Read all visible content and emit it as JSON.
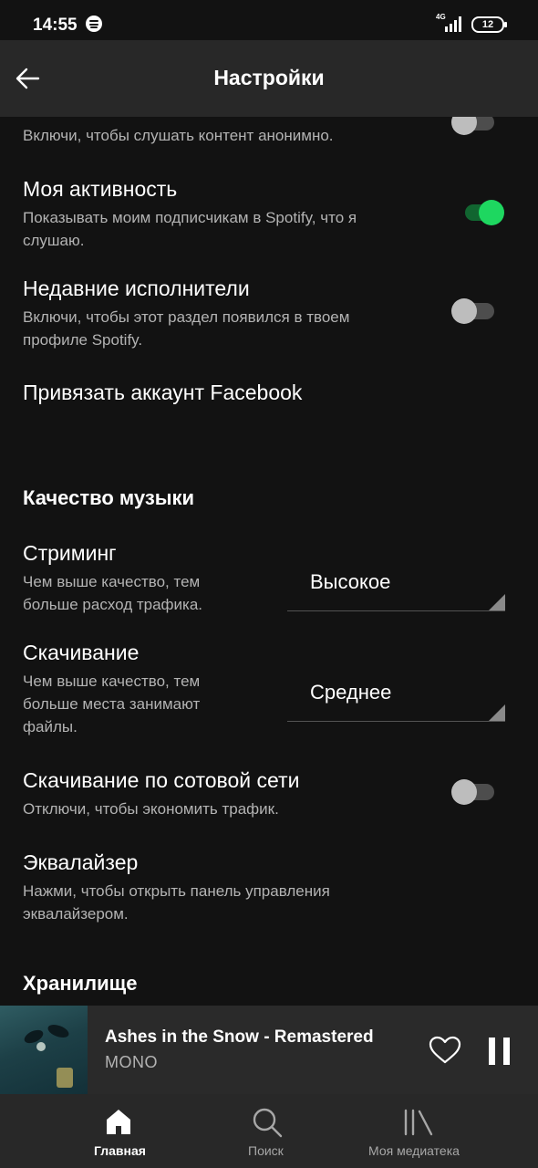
{
  "status_bar": {
    "time": "14:55",
    "network": "4G",
    "battery": "12"
  },
  "header": {
    "title": "Настройки"
  },
  "settings": {
    "private_session": {
      "description": "Включи, чтобы слушать контент анонимно.",
      "enabled": false
    },
    "my_activity": {
      "title": "Моя активность",
      "description_line1": "Показывать моим подписчикам в Spotify, что я",
      "description_line2": "слушаю.",
      "enabled": true
    },
    "recent_artists": {
      "title": "Недавние исполнители",
      "description_line1": "Включи, чтобы этот раздел появился в твоем",
      "description_line2": "профиле Spotify.",
      "enabled": false
    },
    "facebook_link": {
      "title": "Привязать аккаунт Facebook"
    },
    "music_quality": {
      "header": "Качество музыки",
      "streaming": {
        "title": "Стриминг",
        "description_line1": "Чем выше качество, тем",
        "description_line2": "больше расход трафика.",
        "value": "Высокое"
      },
      "download": {
        "title": "Скачивание",
        "description_line1": "Чем выше качество, тем",
        "description_line2": "больше места занимают",
        "description_line3": "файлы.",
        "value": "Среднее"
      },
      "cellular_download": {
        "title": "Скачивание по сотовой сети",
        "description": "Отключи, чтобы экономить трафик.",
        "enabled": false
      },
      "equalizer": {
        "title": "Эквалайзер",
        "description_line1": "Нажми, чтобы открыть панель управления",
        "description_line2": "эквалайзером."
      }
    },
    "storage": {
      "header": "Хранилище"
    }
  },
  "now_playing": {
    "title": "Ashes in the Snow - Remastered",
    "artist": "MONO",
    "playing": true,
    "liked": false
  },
  "bottom_nav": {
    "items": [
      {
        "label": "Главная",
        "icon": "home-icon",
        "active": true
      },
      {
        "label": "Поиск",
        "icon": "search-icon",
        "active": false
      },
      {
        "label": "Моя медиатека",
        "icon": "library-icon",
        "active": false
      }
    ]
  },
  "colors": {
    "accent": "#1ed760",
    "background": "#121212",
    "bar": "#282828"
  }
}
